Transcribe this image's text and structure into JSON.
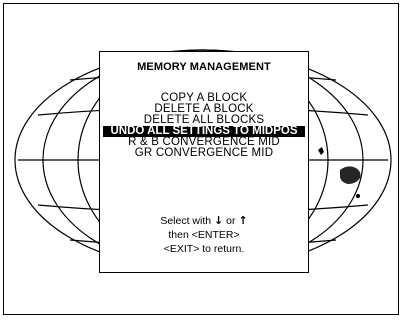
{
  "menu": {
    "title": "MEMORY MANAGEMENT",
    "items": [
      {
        "label": "COPY A BLOCK",
        "selected": false
      },
      {
        "label": "DELETE A BLOCK",
        "selected": false
      },
      {
        "label": "DELETE ALL BLOCKS",
        "selected": false
      },
      {
        "label": "UNDO ALL SETTINGS TO MIDPOS",
        "selected": true
      },
      {
        "label": "R & B CONVERGENCE MID",
        "selected": false
      },
      {
        "label": "GR CONVERGENCE MID",
        "selected": false
      }
    ],
    "help": {
      "line1_prefix": "Select with",
      "down_arrow": "↓",
      "or_word": "or",
      "up_arrow": "↑",
      "line2": "then <ENTER>",
      "line3": "<EXIT> to return."
    }
  },
  "icons": {
    "background": "globe-wireframe-icon",
    "down": "down-arrow-icon",
    "up": "up-arrow-icon"
  },
  "colors": {
    "background": "#ffffff",
    "foreground": "#000000",
    "selected_bg": "#000000",
    "selected_fg": "#ffffff"
  }
}
